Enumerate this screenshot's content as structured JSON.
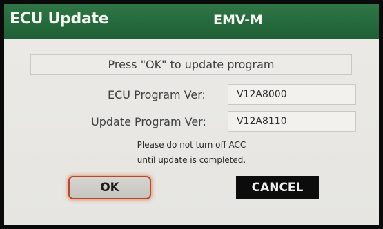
{
  "header": {
    "title": "ECU Update",
    "unit": "EMV-M"
  },
  "message": "Press \"OK\" to update program",
  "versions": {
    "ecu_label": "ECU Program Ver:",
    "ecu_value": "V12A8000",
    "update_label": "Update Program Ver:",
    "update_value": "V12A8110"
  },
  "warning": {
    "line1": "Please do not turn off ACC",
    "line2": "until update is completed."
  },
  "buttons": {
    "ok_label": "OK",
    "cancel_label": "CANCEL"
  },
  "colors": {
    "title_bar": "#2a7042",
    "ok_highlight": "#d0603a",
    "cancel_bg": "#0c0c0c"
  }
}
